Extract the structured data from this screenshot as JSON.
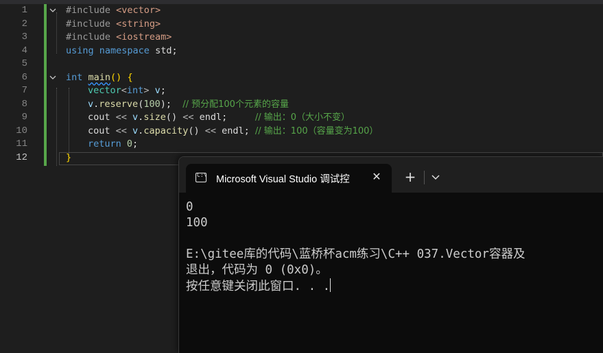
{
  "editor": {
    "lines": [
      {
        "n": "1",
        "tokens": [
          [
            "pp",
            "#include "
          ],
          [
            "inc",
            "<vector>"
          ]
        ]
      },
      {
        "n": "2",
        "tokens": [
          [
            "pp",
            "#include "
          ],
          [
            "inc",
            "<string>"
          ]
        ]
      },
      {
        "n": "3",
        "tokens": [
          [
            "pp",
            "#include "
          ],
          [
            "inc",
            "<iostream>"
          ]
        ]
      },
      {
        "n": "4",
        "tokens": [
          [
            "kw",
            "using "
          ],
          [
            "kw",
            "namespace "
          ],
          [
            "plain",
            "std;"
          ]
        ]
      },
      {
        "n": "5",
        "tokens": []
      },
      {
        "n": "6",
        "tokens": [
          [
            "kw",
            "int "
          ],
          [
            "fn",
            "main"
          ],
          [
            "br",
            "()"
          ],
          [
            "plain",
            " "
          ],
          [
            "br",
            "{"
          ]
        ]
      },
      {
        "n": "7",
        "tokens": [
          [
            "ty",
            "vector"
          ],
          [
            "op",
            "<"
          ],
          [
            "kw",
            "int"
          ],
          [
            "op",
            "> "
          ],
          [
            "var",
            "v"
          ],
          [
            "plain",
            ";"
          ]
        ]
      },
      {
        "n": "8",
        "tokens": [
          [
            "var",
            "v"
          ],
          [
            "plain",
            "."
          ],
          [
            "fn",
            "reserve"
          ],
          [
            "plain",
            "("
          ],
          [
            "num",
            "100"
          ],
          [
            "plain",
            ");  "
          ],
          [
            "cm",
            "// 预分配100个元素的容量"
          ]
        ]
      },
      {
        "n": "9",
        "tokens": [
          [
            "plain",
            "cout "
          ],
          [
            "op",
            "<< "
          ],
          [
            "var",
            "v"
          ],
          [
            "plain",
            "."
          ],
          [
            "fn",
            "size"
          ],
          [
            "plain",
            "() "
          ],
          [
            "op",
            "<< "
          ],
          [
            "plain",
            "endl;     "
          ],
          [
            "cm",
            "// 输出：0（大小不变）"
          ]
        ]
      },
      {
        "n": "10",
        "tokens": [
          [
            "plain",
            "cout "
          ],
          [
            "op",
            "<< "
          ],
          [
            "var",
            "v"
          ],
          [
            "plain",
            "."
          ],
          [
            "fn",
            "capacity"
          ],
          [
            "plain",
            "() "
          ],
          [
            "op",
            "<< "
          ],
          [
            "plain",
            "endl; "
          ],
          [
            "cm",
            "// 输出：100（容量变为100）"
          ]
        ]
      },
      {
        "n": "11",
        "tokens": [
          [
            "kw",
            "return "
          ],
          [
            "num",
            "0"
          ],
          [
            "plain",
            ";"
          ]
        ]
      },
      {
        "n": "12",
        "tokens": [
          [
            "br",
            "}"
          ]
        ]
      }
    ]
  },
  "terminal": {
    "tab_title": "Microsoft Visual Studio 调试控",
    "close_label": "✕",
    "add_label": "+",
    "output": [
      "0",
      "100",
      "",
      "E:\\gitee库的代码\\蓝桥杯acm练习\\C++ 037.Vector容器及",
      "退出，代码为 0 (0x0)。",
      "按任意键关闭此窗口. . ."
    ]
  }
}
